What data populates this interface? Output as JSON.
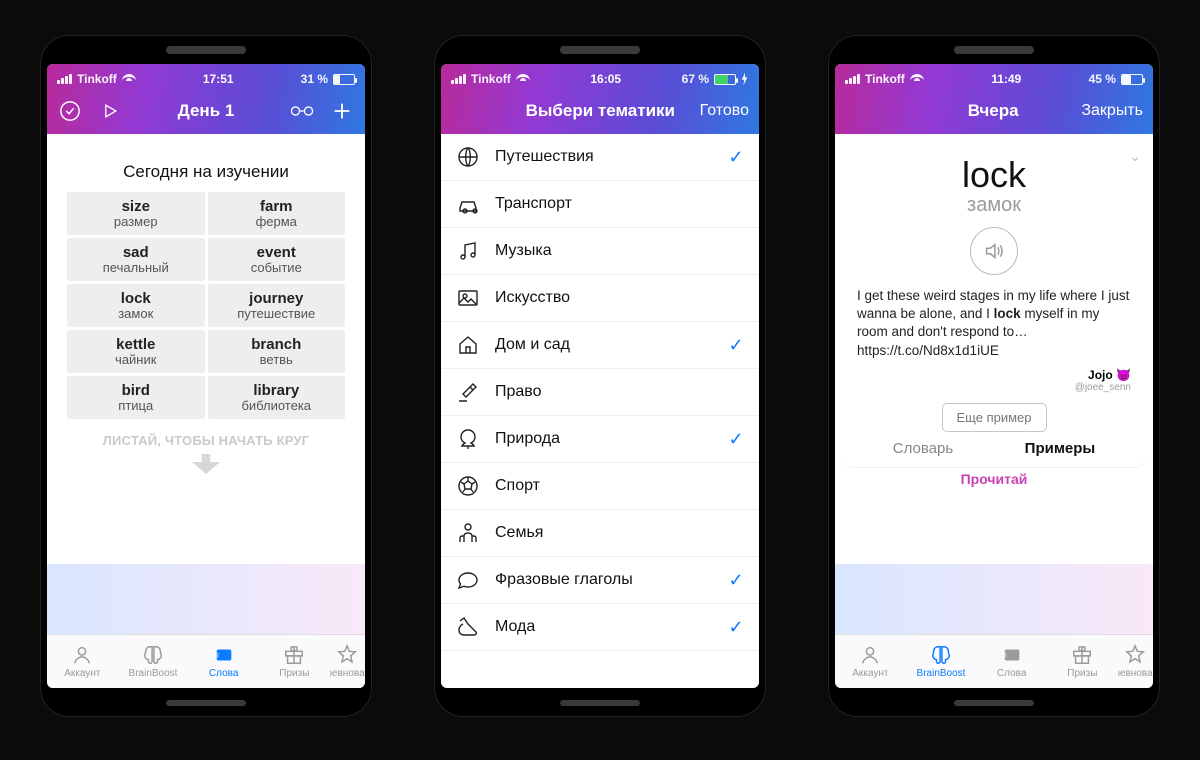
{
  "screens": {
    "s1": {
      "status": {
        "carrier": "Tinkoff",
        "time": "17:51",
        "battery_pct": "31 %",
        "battery_fill": 31
      },
      "nav": {
        "title": "День 1"
      },
      "card_title": "Сегодня на изучении",
      "words": [
        {
          "en": "size",
          "ru": "размер"
        },
        {
          "en": "farm",
          "ru": "ферма"
        },
        {
          "en": "sad",
          "ru": "печальный"
        },
        {
          "en": "event",
          "ru": "событие"
        },
        {
          "en": "lock",
          "ru": "замок"
        },
        {
          "en": "journey",
          "ru": "путешествие"
        },
        {
          "en": "kettle",
          "ru": "чайник"
        },
        {
          "en": "branch",
          "ru": "ветвь"
        },
        {
          "en": "bird",
          "ru": "птица"
        },
        {
          "en": "library",
          "ru": "библиотека"
        }
      ],
      "swipe_hint": "ЛИСТАЙ, ЧТОБЫ НАЧАТЬ КРУГ",
      "tabs": [
        {
          "label": "Аккаунт"
        },
        {
          "label": "BrainBoost"
        },
        {
          "label": "Слова"
        },
        {
          "label": "Призы"
        },
        {
          "label": "Соревнования"
        }
      ],
      "active_tab": "Слова"
    },
    "s2": {
      "status": {
        "carrier": "Tinkoff",
        "time": "16:05",
        "battery_pct": "67 %",
        "battery_fill": 67
      },
      "nav": {
        "title": "Выбери тематики",
        "done": "Готово"
      },
      "rows": [
        {
          "icon": "globe",
          "label": "Путешествия",
          "checked": true
        },
        {
          "icon": "car",
          "label": "Транспорт",
          "checked": false
        },
        {
          "icon": "music",
          "label": "Музыка",
          "checked": false
        },
        {
          "icon": "art",
          "label": "Искусство",
          "checked": false
        },
        {
          "icon": "home",
          "label": "Дом и сад",
          "checked": true
        },
        {
          "icon": "law",
          "label": "Право",
          "checked": false
        },
        {
          "icon": "nature",
          "label": "Природа",
          "checked": true
        },
        {
          "icon": "sport",
          "label": "Спорт",
          "checked": false
        },
        {
          "icon": "family",
          "label": "Семья",
          "checked": false
        },
        {
          "icon": "phrasal",
          "label": "Фразовые глаголы",
          "checked": true
        },
        {
          "icon": "fashion",
          "label": "Мода",
          "checked": true
        }
      ]
    },
    "s3": {
      "status": {
        "carrier": "Tinkoff",
        "time": "11:49",
        "battery_pct": "45 %",
        "battery_fill": 45
      },
      "nav": {
        "title": "Вчера",
        "close": "Закрыть"
      },
      "word": "lock",
      "translation": "замок",
      "example_pre": "I get these weird stages in my life where I just wanna be alone, and I ",
      "example_bold": "lock",
      "example_post": " myself in my room and don't respond to…",
      "example_url": "https://t.co/Nd8x1d1iUE",
      "author_name": "Jojo 😈",
      "author_handle": "@joee_senn",
      "more_btn": "Еще пример",
      "left_tab": "Словарь",
      "right_tab": "Примеры",
      "read_hint": "Прочитай",
      "tabs": [
        {
          "label": "Аккаунт"
        },
        {
          "label": "BrainBoost"
        },
        {
          "label": "Слова"
        },
        {
          "label": "Призы"
        },
        {
          "label": "Соревнования"
        }
      ],
      "active_tab": "BrainBoost"
    }
  }
}
